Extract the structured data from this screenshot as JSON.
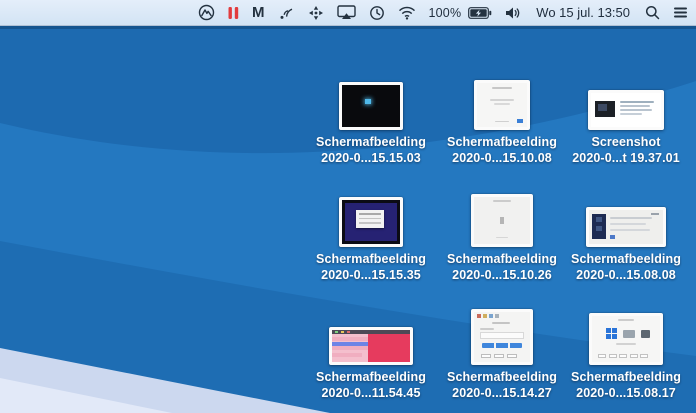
{
  "menubar": {
    "battery_percent": "100%",
    "clock": "Wo 15 jul. 13:50",
    "icons": [
      "nordvpn-icon",
      "pause-icon",
      "malwarebytes-icon",
      "signal-icon",
      "crosshair-icon",
      "airplay-icon",
      "time-machine-icon",
      "wifi-icon",
      "battery-charging-icon",
      "volume-icon",
      "spotlight-search-icon",
      "notification-list-icon"
    ],
    "malwarebytes_glyph": "M"
  },
  "desktop": {
    "icons": [
      {
        "line1": "Schermafbeelding",
        "line2": "2020-0...15.15.03",
        "thumb": "black-screen-blue-dot"
      },
      {
        "line1": "Schermafbeelding",
        "line2": "2020-0...15.10.08",
        "thumb": "white-dialog"
      },
      {
        "line1": "Screenshot",
        "line2": "2020-0...t 19.37.01",
        "thumb": "wide-document-dark-left"
      },
      {
        "line1": "Schermafbeelding",
        "line2": "2020-0...15.15.35",
        "thumb": "indigo-window"
      },
      {
        "line1": "Schermafbeelding",
        "line2": "2020-0...15.10.26",
        "thumb": "gray-dialog"
      },
      {
        "line1": "Schermafbeelding",
        "line2": "2020-0...15.08.08",
        "thumb": "wide-installer"
      },
      {
        "line1": "Schermafbeelding",
        "line2": "2020-0...11.54.45",
        "thumb": "pink-spreadsheet"
      },
      {
        "line1": "Schermafbeelding",
        "line2": "2020-0...15.14.27",
        "thumb": "dialog-blue-buttons"
      },
      {
        "line1": "Schermafbeelding",
        "line2": "2020-0...15.08.17",
        "thumb": "dialog-windows-logo"
      }
    ]
  },
  "colors": {
    "menubar_bg": "#d9e8f6",
    "menubar_text": "#1f2d3d",
    "pause_red": "#e23c3e",
    "wallpaper_base": "#2478c0",
    "wallpaper_band_top": "#1d6ab0",
    "wallpaper_band_bottom": "#1e6db3",
    "wallpaper_corner_light": "#ccd8ef",
    "label_text": "#ffffff",
    "thumb_dot_blue": "#4fb9ea",
    "thumb_crimson": "#e63b5e",
    "windows_logo_blue": "#2a74d8"
  }
}
